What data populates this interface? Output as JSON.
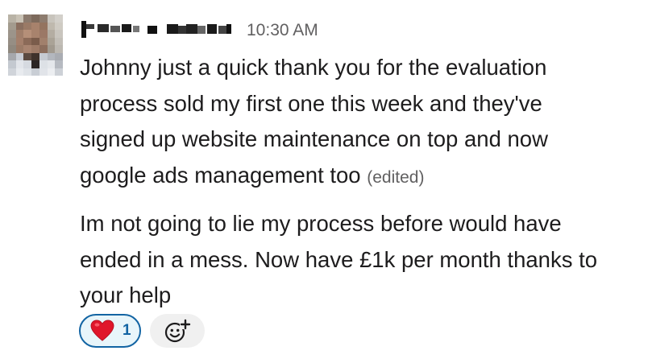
{
  "message": {
    "sender_name": "",
    "timestamp": "10:30 AM",
    "paragraph_1": "Johnny just a quick thank you for the evaluation\nprocess sold my first one this week and they've\nsigned up website maintenance on top and now\ngoogle ads management too ",
    "edited_label": "(edited)",
    "paragraph_2": "Im not going to lie my process before would have\nended in a mess. Now have £1k per month thanks to\nyour help"
  },
  "reactions": [
    {
      "emoji": "heart-icon",
      "count": "1",
      "selected": true
    }
  ],
  "add_reaction": {
    "icon": "add-emoji-icon"
  },
  "colors": {
    "selected_reaction_border": "#1264a3",
    "selected_reaction_bg": "#e8f5fa",
    "add_reaction_bg": "#f0f0f0",
    "meta_text": "#616061"
  }
}
